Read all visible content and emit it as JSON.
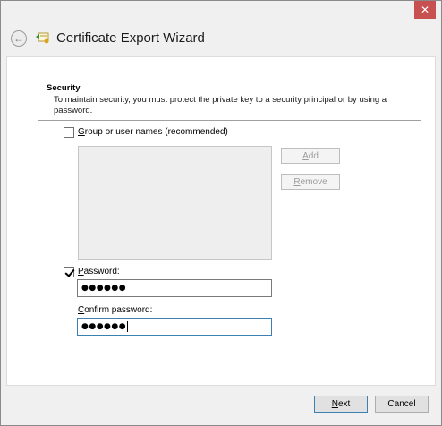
{
  "window": {
    "close_glyph": "✕"
  },
  "header": {
    "back_glyph": "←",
    "title": "Certificate Export Wizard"
  },
  "security": {
    "heading": "Security",
    "description": "To maintain security, you must protect the private key to a security principal or by using a password.",
    "group_option": {
      "mnemonic": "G",
      "rest": "roup or user names (recommended)",
      "checked": false
    },
    "add_button": {
      "mnemonic": "A",
      "rest": "dd",
      "enabled": false
    },
    "remove_button": {
      "mnemonic": "R",
      "rest": "emove",
      "enabled": false
    },
    "password_option": {
      "mnemonic": "P",
      "rest": "assword:",
      "checked": true
    },
    "password_value": "●●●●●●",
    "confirm_label": {
      "mnemonic": "C",
      "rest": "onfirm password:"
    },
    "confirm_value": "●●●●●●"
  },
  "footer": {
    "next_button": {
      "mnemonic": "N",
      "rest": "ext"
    },
    "cancel_label": "Cancel"
  }
}
